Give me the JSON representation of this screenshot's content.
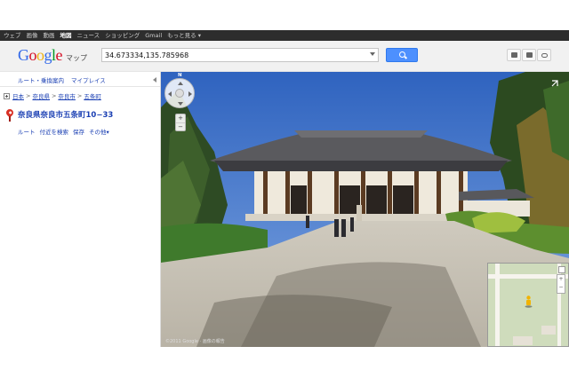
{
  "topbar": {
    "links": [
      "ウェブ",
      "画像",
      "動画",
      "地図",
      "ニュース",
      "ショッピング",
      "Gmail",
      "もっと見る ▾"
    ],
    "active_index": 3
  },
  "header": {
    "logo_text": "Google",
    "logo_suffix": "マップ",
    "search": {
      "value": "34.673334,135.785968"
    },
    "icons": [
      "print-icon",
      "mail-icon",
      "link-icon"
    ]
  },
  "left_panel": {
    "tabs": {
      "route": "ルート・乗換案内",
      "my_places": "マイプレイス"
    },
    "breadcrumb": [
      "日本",
      "奈良県",
      "奈良市",
      "五条町"
    ],
    "place": {
      "title": "奈良県奈良市五条町10−33",
      "actions": [
        "ルート",
        "付近を検索",
        "保存",
        "その他▾"
      ]
    }
  },
  "street_view": {
    "compass_label": "N",
    "zoom": {
      "in": "+",
      "out": "−"
    },
    "copyright": "©2011 Google · 画像の報告"
  },
  "minimap": {
    "zoom_in": "+",
    "zoom_out": "−"
  },
  "colors": {
    "topbar": "#2d2d2d",
    "link": "#1a3fb3",
    "search_button": "#4d90fe",
    "pin": "#d93025",
    "sky": "#3b6fc6"
  }
}
